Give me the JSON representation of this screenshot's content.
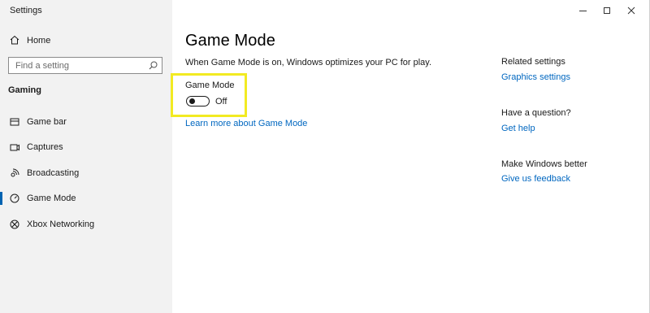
{
  "window": {
    "title": "Settings"
  },
  "sidebar": {
    "home_label": "Home",
    "search_placeholder": "Find a setting",
    "section_title": "Gaming",
    "items": [
      {
        "label": "Game bar",
        "icon": "game-bar-icon",
        "active": false
      },
      {
        "label": "Captures",
        "icon": "captures-icon",
        "active": false
      },
      {
        "label": "Broadcasting",
        "icon": "broadcasting-icon",
        "active": false
      },
      {
        "label": "Game Mode",
        "icon": "game-mode-icon",
        "active": true
      },
      {
        "label": "Xbox Networking",
        "icon": "xbox-icon",
        "active": false
      }
    ]
  },
  "main": {
    "title": "Game Mode",
    "description": "When Game Mode is on, Windows optimizes your PC for play.",
    "setting_label": "Game Mode",
    "toggle_state": "Off",
    "learn_more": "Learn more about Game Mode"
  },
  "related": {
    "related_heading": "Related settings",
    "graphics_link": "Graphics settings",
    "question_heading": "Have a question?",
    "help_link": "Get help",
    "better_heading": "Make Windows better",
    "feedback_link": "Give us feedback"
  },
  "colors": {
    "accent": "#0063b1",
    "link": "#0067c0",
    "highlight": "#f2ea22",
    "sidebar_bg": "#f2f2f2"
  }
}
